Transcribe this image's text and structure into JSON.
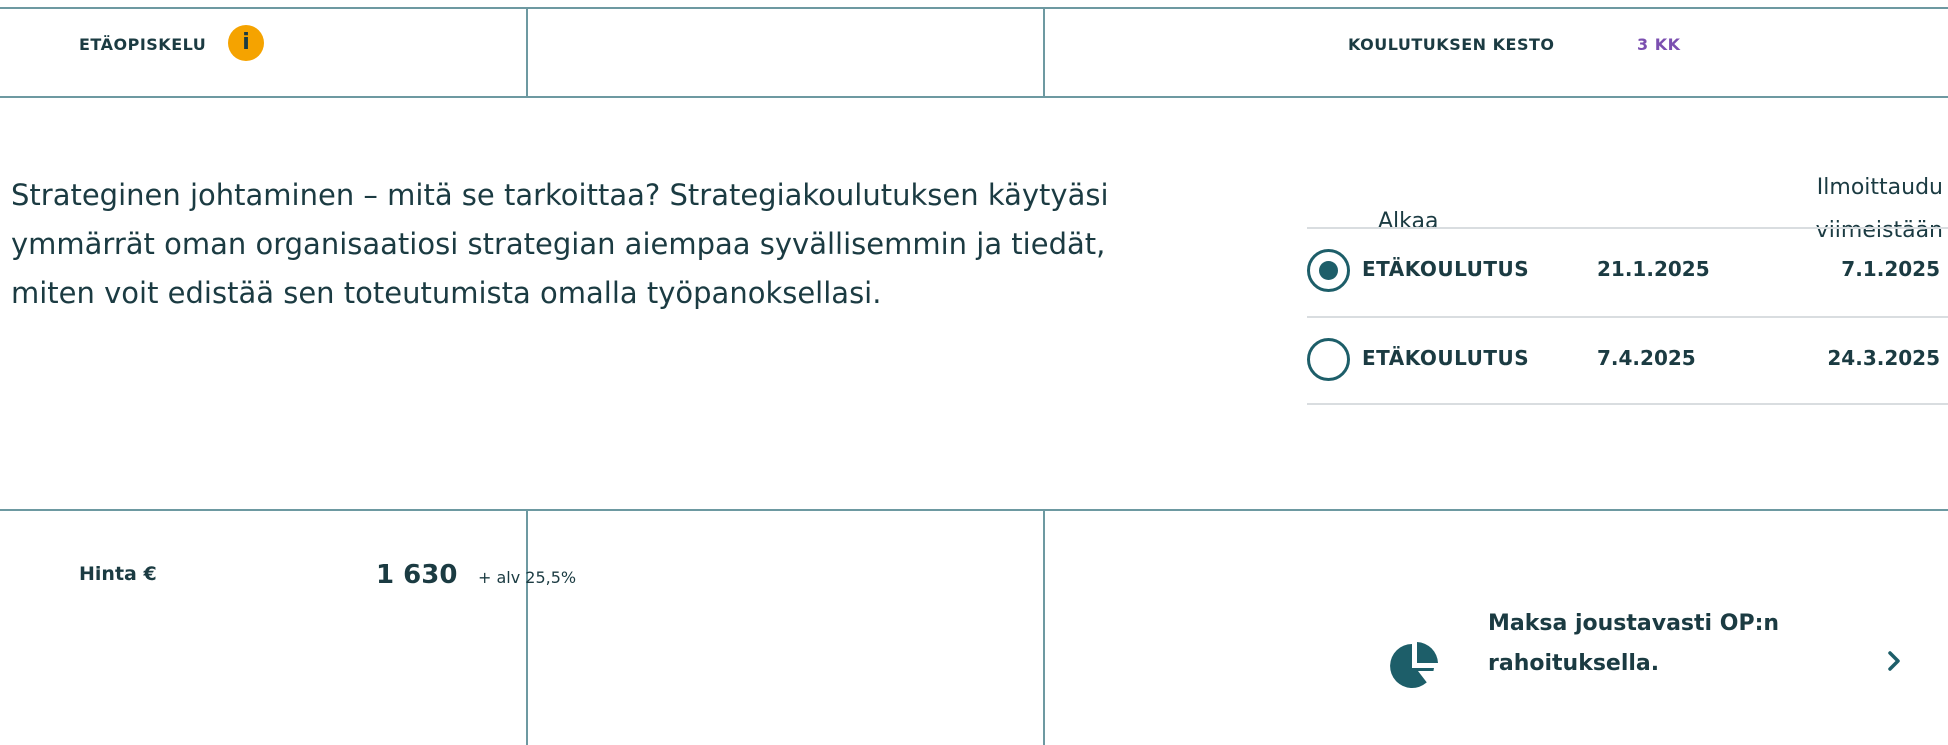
{
  "header": {
    "mode_label": "ETÄOPISKELU",
    "info_icon": "info-icon",
    "info_icon_glyph": "i",
    "duration_label": "KOULUTUKSEN KESTO",
    "duration_value": "3 KK"
  },
  "description": "Strateginen johtaminen – mitä se tarkoittaa? Strategiakoulutuksen käytyäsi ymmärrät oman organisaatiosi strategian aiempaa syvällisemmin ja tiedät, miten voit edistää sen toteutumista omalla työpanoksellasi.",
  "schedule": {
    "col_start": "Alkaa",
    "col_deadline_line1": "Ilmoittaudu",
    "col_deadline_line2": "viimeistään",
    "rows": [
      {
        "name": "ETÄKOULUTUS",
        "start": "21.1.2025",
        "deadline": "7.1.2025",
        "selected": true
      },
      {
        "name": "ETÄKOULUTUS",
        "start": "7.4.2025",
        "deadline": "24.3.2025",
        "selected": false
      }
    ]
  },
  "price": {
    "label": "Hinta €",
    "value": "1 630",
    "vat": "+ alv 25,5%"
  },
  "financing": {
    "icon": "pie-chart-icon",
    "text": "Maksa joustavasti OP:n rahoituksella.",
    "arrow_icon": "chevron-right-icon"
  },
  "colors": {
    "border": "#6d99a1",
    "text": "#1b3b42",
    "accent_purple": "#7b4fb0",
    "info_orange": "#f5a300",
    "teal": "#1d5e69"
  }
}
